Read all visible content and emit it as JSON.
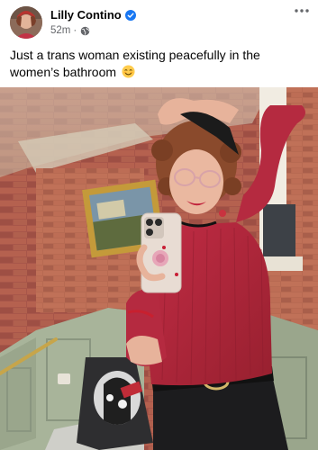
{
  "post": {
    "author_name": "Lilly Contino",
    "verified_icon": "verified-badge-icon",
    "timestamp": "52m",
    "separator": "·",
    "audience_icon": "globe-icon",
    "more_icon": "more-options-icon",
    "caption": "Just a trans woman existing peacefully in the women’s bathroom",
    "caption_emoji": "smiling-face-emoji",
    "photo_alt": "mirror-selfie-photo"
  },
  "colors": {
    "verified_blue": "#1877f2",
    "secondary_text": "#65676b",
    "primary_text": "#050505",
    "sweater_red": "#b0243a"
  }
}
